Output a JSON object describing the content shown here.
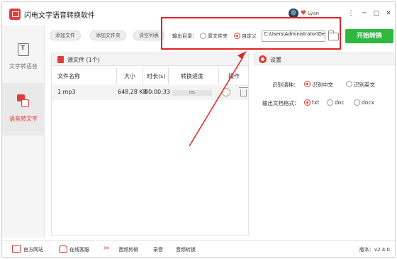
{
  "app": {
    "title": "闪电文字语音转换软件",
    "username": "Lyan",
    "window_controls": [
      "⋮",
      "─",
      "□",
      "✕"
    ]
  },
  "sidebar": {
    "items": [
      {
        "label": "文字转语音",
        "active": false,
        "icon": "text-doc-icon"
      },
      {
        "label": "语音转文字",
        "active": true,
        "icon": "speech-to-text-icon"
      }
    ]
  },
  "toolbar": {
    "add_file": "添加文件",
    "add_folder": "添加文件夹",
    "clear_list": "清空列表"
  },
  "output": {
    "label": "输出目录：",
    "options": [
      "原文件夹",
      "自定义"
    ],
    "selected": "自定义",
    "path": "C:\\Users\\Administrator\\De",
    "folder_icon": "folder-icon"
  },
  "start_button": "开始转换",
  "file_panel": {
    "title": "源文件 (1个)",
    "columns": [
      "文件名称",
      "大小",
      "时长(s)",
      "转换进度",
      "操作"
    ],
    "rows": [
      {
        "name": "1.mp3",
        "size": "648.28 KB",
        "duration": "00:00:33",
        "progress": "0%",
        "progress_value": 0
      }
    ]
  },
  "settings": {
    "title": "设置",
    "language_label": "识别语种：",
    "language_options": [
      "识别中文",
      "识别英文"
    ],
    "language_selected": "识别中文",
    "format_label": "输出文档格式：",
    "format_options": [
      "txt",
      "doc",
      "docx"
    ],
    "format_selected": "txt"
  },
  "footer": {
    "items": [
      "官方网站",
      "在线客服",
      "音频剪辑",
      "录音",
      "音频转换"
    ],
    "version": "版本：v2.4.0"
  },
  "colors": {
    "accent": "#e23b3b",
    "start_button": "#2eb840",
    "highlight_box": "#e52222"
  }
}
